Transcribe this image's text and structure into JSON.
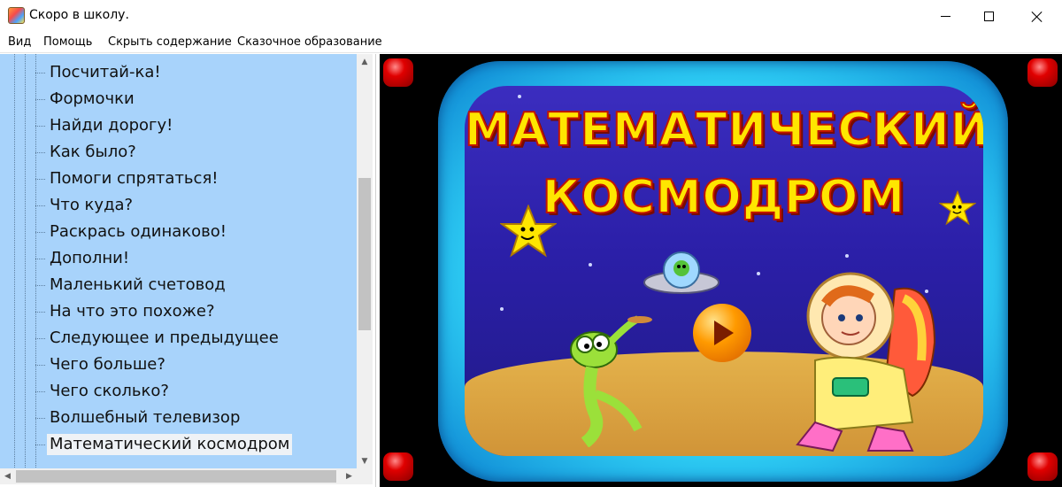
{
  "window": {
    "title": "Скоро в школу."
  },
  "menu": [
    "Вид",
    "Помощь",
    "Скрыть содержание",
    "Сказочное образование"
  ],
  "tree": {
    "items": [
      "Посчитай-ка!",
      "Формочки",
      "Найди дорогу!",
      "Как было?",
      "Помоги спрятаться!",
      "Что куда?",
      "Раскрась одинаково!",
      "Дополни!",
      "Маленький счетовод",
      "На что это похоже?",
      "Следующее и предыдущее",
      "Чего больше?",
      "Чего сколько?",
      "Волшебный телевизор",
      "Математический космодром"
    ],
    "selected": "Математический космодром"
  },
  "game": {
    "title_line1": "МАТЕМАТИЧЕСКИЙ",
    "title_line2": "КОСМОДРОМ"
  },
  "icons": {
    "play": "play-icon",
    "red_buttons": "red-round-button"
  },
  "colors": {
    "sidebar_bg": "#a8d3fb",
    "frame": "#2fd0f5",
    "title_fill": "#ffe600",
    "title_stroke": "#c21400"
  }
}
